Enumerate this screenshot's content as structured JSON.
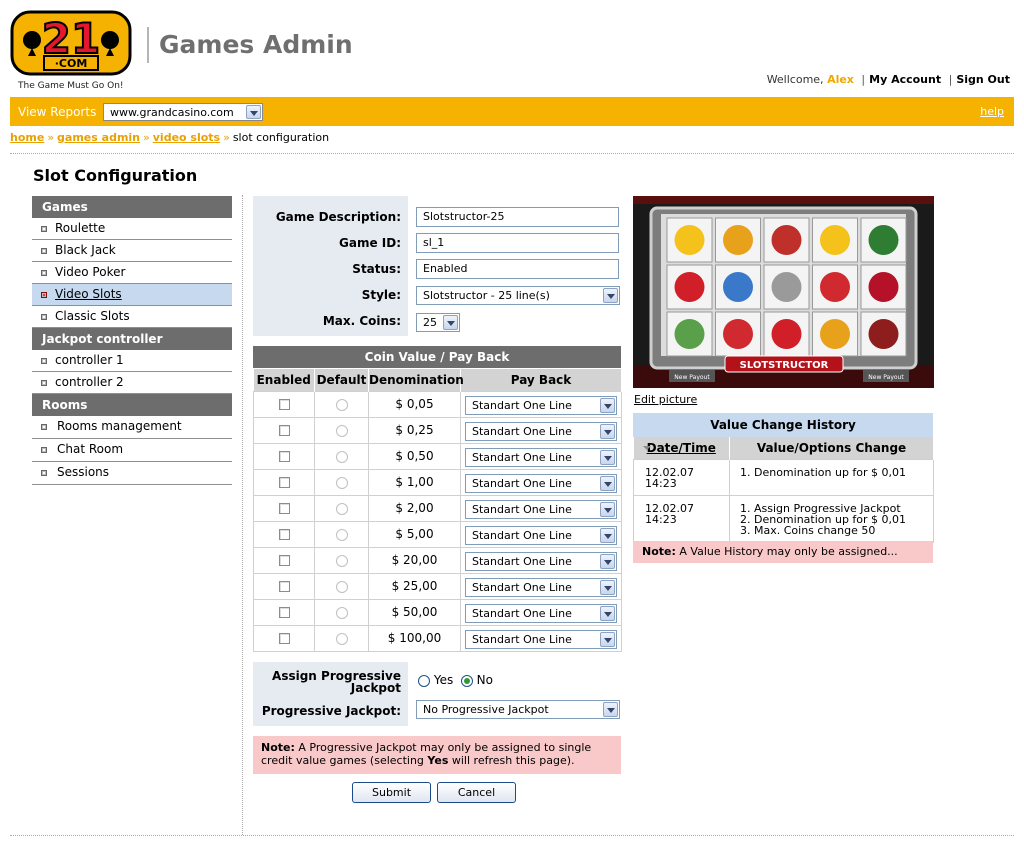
{
  "header": {
    "logo_number": "21",
    "logo_sub": "·COM",
    "tagline": "The Game Must Go On!",
    "app_title": "Games Admin",
    "welcome": "Wellcome,",
    "user_name": "Alex",
    "my_account": "My Account",
    "sign_out": "Sign Out"
  },
  "topbar": {
    "view_reports": "View Reports",
    "site_select_value": "www.grandcasino.com",
    "help": "help"
  },
  "breadcrumb": {
    "items": [
      "home",
      "games admin",
      "video slots"
    ],
    "current": "slot configuration"
  },
  "page_title": "Slot Configuration",
  "sidebar": {
    "games_header": "Games",
    "games": [
      "Roulette",
      "Black Jack",
      "Video Poker",
      "Video Slots",
      "Classic Slots"
    ],
    "active_item": "Video Slots",
    "jackpot_header": "Jackpot controller",
    "jackpot": [
      "controller 1",
      "controller 2"
    ],
    "rooms_header": "Rooms",
    "rooms": [
      "Rooms management",
      "Chat Room",
      "Sessions"
    ]
  },
  "form": {
    "game_description_label": "Game Description:",
    "game_description_value": "Slotstructor-25",
    "game_id_label": "Game ID:",
    "game_id_value": "sl_1",
    "status_label": "Status:",
    "status_value": "Enabled",
    "style_label": "Style:",
    "style_value": "Slotstructor - 25 line(s)",
    "max_coins_label": "Max. Coins:",
    "max_coins_value": "25"
  },
  "coin_table": {
    "title": "Coin Value / Pay Back",
    "headers": [
      "Enabled",
      "Default",
      "Denomination",
      "Pay Back"
    ],
    "rows": [
      {
        "denomination": "$ 0,05",
        "payback": "Standart One Line"
      },
      {
        "denomination": "$ 0,25",
        "payback": "Standart One Line"
      },
      {
        "denomination": "$ 0,50",
        "payback": "Standart One Line"
      },
      {
        "denomination": "$ 1,00",
        "payback": "Standart One Line"
      },
      {
        "denomination": "$ 2,00",
        "payback": "Standart One Line"
      },
      {
        "denomination": "$ 5,00",
        "payback": "Standart One Line"
      },
      {
        "denomination": "$ 20,00",
        "payback": "Standart One Line"
      },
      {
        "denomination": "$ 25,00",
        "payback": "Standart One Line"
      },
      {
        "denomination": "$ 50,00",
        "payback": "Standart One Line"
      },
      {
        "denomination": "$ 100,00",
        "payback": "Standart One Line"
      }
    ]
  },
  "jackpot_form": {
    "assign_label": "Assign Progressive Jackpot",
    "yes": "Yes",
    "no": "No",
    "selected": "No",
    "jackpot_label": "Progressive Jackpot:",
    "jackpot_value": "No Progressive Jackpot"
  },
  "note_jackpot": {
    "prefix": "Note:",
    "text_1": "A Progressive Jackpot may only be assigned to single credit value games (selecting",
    "bold": "Yes",
    "text_2": "will refresh this page)."
  },
  "buttons": {
    "submit": "Submit",
    "cancel": "Cancel"
  },
  "game_picture": {
    "edit_label": "Edit picture",
    "banner": "SLOTSTRUCTOR",
    "left_tag": "New Payout",
    "right_tag": "New Payout",
    "symbols": [
      "sun",
      "boom",
      "king",
      "sun",
      "bag",
      "wild",
      "letter-a",
      "clock",
      "flower",
      "thirteen",
      "envelope",
      "flower",
      "wild",
      "boom",
      "gear"
    ]
  },
  "history": {
    "title": "Value Change History",
    "headers": [
      "Date/Time",
      "Value/Options Change"
    ],
    "rows": [
      {
        "date": "12.02.07 14:23",
        "changes": [
          "1. Denomination up for $ 0,01"
        ]
      },
      {
        "date": "12.02.07 14:23",
        "changes": [
          "1. Assign Progressive Jackpot",
          "2. Denomination up for $ 0,01",
          "3. Max. Coins change 50"
        ]
      }
    ]
  },
  "note_history": {
    "prefix": "Note:",
    "text": "A Value History may only be assigned..."
  },
  "colors": {
    "accent_orange": "#f5b200",
    "header_gray": "#6d6d6d",
    "active_blue": "#c6d9ee",
    "note_pink": "#f9c8c8"
  }
}
